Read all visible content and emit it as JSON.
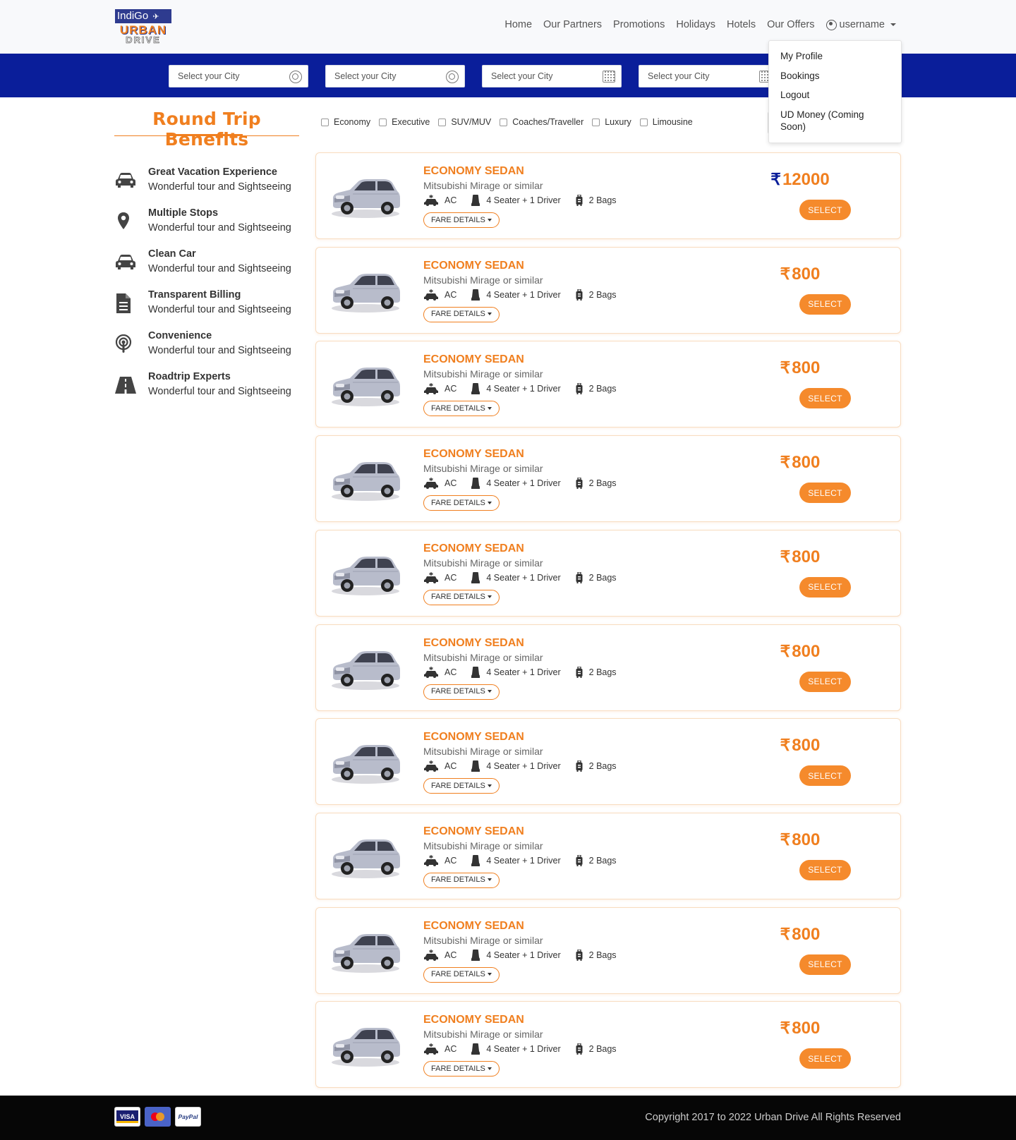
{
  "brand": {
    "line1": "IndiGo",
    "line2": "URBAN",
    "line3": "DRIVE"
  },
  "nav": {
    "items": [
      "Home",
      "Our Partners",
      "Promotions",
      "Holidays",
      "Hotels",
      "Our Offers"
    ],
    "user": "username"
  },
  "dropdown": [
    "My Profile",
    "Bookings",
    "Logout",
    "UD Money (Coming Soon)"
  ],
  "search": {
    "f1": "Select your City",
    "f2": "Select your City",
    "f3": "Select your City",
    "f4": "Select your City"
  },
  "benefits": {
    "title": "Round Trip Benefits",
    "items": [
      {
        "title": "Great Vacation Experience",
        "sub": "Wonderful tour and Sightseeing",
        "icon": "car-icon"
      },
      {
        "title": "Multiple Stops",
        "sub": "Wonderful tour and Sightseeing",
        "icon": "map-pin-icon"
      },
      {
        "title": "Clean Car",
        "sub": "Wonderful tour and Sightseeing",
        "icon": "car-icon"
      },
      {
        "title": "Transparent Billing",
        "sub": "Wonderful tour and Sightseeing",
        "icon": "document-icon"
      },
      {
        "title": "Convenience",
        "sub": "Wonderful tour and Sightseeing",
        "icon": "podcast-icon"
      },
      {
        "title": "Roadtrip Experts",
        "sub": "Wonderful tour and Sightseeing",
        "icon": "road-icon"
      }
    ]
  },
  "filters": [
    "Economy",
    "Executive",
    "SUV/MUV",
    "Coaches/Traveller",
    "Luxury",
    "Limousine"
  ],
  "cards": [
    {
      "title": "ECONOMY SEDAN",
      "sub": "Mitsubishi Mirage or similar",
      "ac": "AC",
      "seats": "4 Seater + 1 Driver",
      "bags": "2 Bags",
      "fare": "FARE DETAILS",
      "price": "12000",
      "select": "SELECT"
    },
    {
      "title": "ECONOMY SEDAN",
      "sub": "Mitsubishi Mirage or similar",
      "ac": "AC",
      "seats": "4 Seater + 1 Driver",
      "bags": "2 Bags",
      "fare": "FARE DETAILS",
      "price": "800",
      "select": "SELECT"
    },
    {
      "title": "ECONOMY SEDAN",
      "sub": "Mitsubishi Mirage or similar",
      "ac": "AC",
      "seats": "4 Seater + 1 Driver",
      "bags": "2 Bags",
      "fare": "FARE DETAILS",
      "price": "800",
      "select": "SELECT"
    },
    {
      "title": "ECONOMY SEDAN",
      "sub": "Mitsubishi Mirage or similar",
      "ac": "AC",
      "seats": "4 Seater + 1 Driver",
      "bags": "2 Bags",
      "fare": "FARE DETAILS",
      "price": "800",
      "select": "SELECT"
    },
    {
      "title": "ECONOMY SEDAN",
      "sub": "Mitsubishi Mirage or similar",
      "ac": "AC",
      "seats": "4 Seater + 1 Driver",
      "bags": "2 Bags",
      "fare": "FARE DETAILS",
      "price": "800",
      "select": "SELECT"
    },
    {
      "title": "ECONOMY SEDAN",
      "sub": "Mitsubishi Mirage or similar",
      "ac": "AC",
      "seats": "4 Seater + 1 Driver",
      "bags": "2 Bags",
      "fare": "FARE DETAILS",
      "price": "800",
      "select": "SELECT"
    },
    {
      "title": "ECONOMY SEDAN",
      "sub": "Mitsubishi Mirage or similar",
      "ac": "AC",
      "seats": "4 Seater + 1 Driver",
      "bags": "2 Bags",
      "fare": "FARE DETAILS",
      "price": "800",
      "select": "SELECT"
    },
    {
      "title": "ECONOMY SEDAN",
      "sub": "Mitsubishi Mirage or similar",
      "ac": "AC",
      "seats": "4 Seater + 1 Driver",
      "bags": "2 Bags",
      "fare": "FARE DETAILS",
      "price": "800",
      "select": "SELECT"
    },
    {
      "title": "ECONOMY SEDAN",
      "sub": "Mitsubishi Mirage or similar",
      "ac": "AC",
      "seats": "4 Seater + 1 Driver",
      "bags": "2 Bags",
      "fare": "FARE DETAILS",
      "price": "800",
      "select": "SELECT"
    },
    {
      "title": "ECONOMY SEDAN",
      "sub": "Mitsubishi Mirage or similar",
      "ac": "AC",
      "seats": "4 Seater + 1 Driver",
      "bags": "2 Bags",
      "fare": "FARE DETAILS",
      "price": "800",
      "select": "SELECT"
    }
  ],
  "currency": "₹",
  "footer": {
    "copyright": "Copyright 2017 to 2022 Urban Drive All Rights Reserved",
    "payments": [
      "VISA",
      "mastercard",
      "PayPal"
    ]
  },
  "colors": {
    "brand_orange": "#f07f1f",
    "brand_blue": "#0a1e9a",
    "footer_bg": "#060606"
  }
}
